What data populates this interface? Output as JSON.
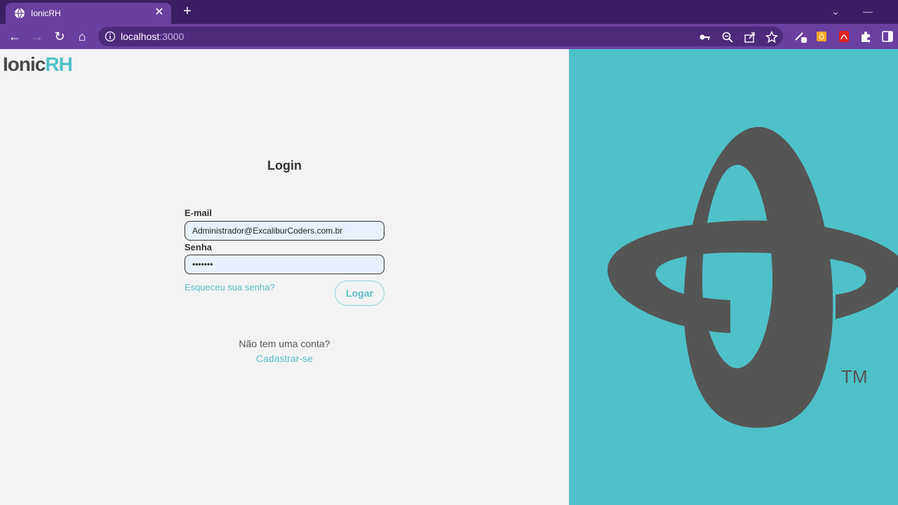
{
  "browser": {
    "tab_title": "IonicRH",
    "url_host": "localhost",
    "url_port": ":3000"
  },
  "page": {
    "logo_part1": "Ionic",
    "logo_part2": "RH",
    "title": "Login",
    "email_label": "E-mail",
    "email_value": "Administrador@ExcaliburCoders.com.br",
    "password_label": "Senha",
    "password_value": "•••••••",
    "forgot_link": "Esqueceu sua senha?",
    "login_button": "Logar",
    "no_account_text": "Não tem uma conta?",
    "signup_link": "Cadastrar-se",
    "trademark": "TM"
  },
  "colors": {
    "accent": "#4fc1c9",
    "logo_dark": "#4a4a4a",
    "browser_frame": "#3b1f63",
    "browser_toolbar": "#6b3fa0"
  },
  "icons": [
    "globe-icon",
    "close-icon",
    "plus-icon",
    "back-icon",
    "forward-icon",
    "reload-icon",
    "home-icon",
    "info-icon",
    "key-icon",
    "zoom-icon",
    "share-icon",
    "star-icon",
    "puzzle-icon",
    "sidebar-icon"
  ]
}
